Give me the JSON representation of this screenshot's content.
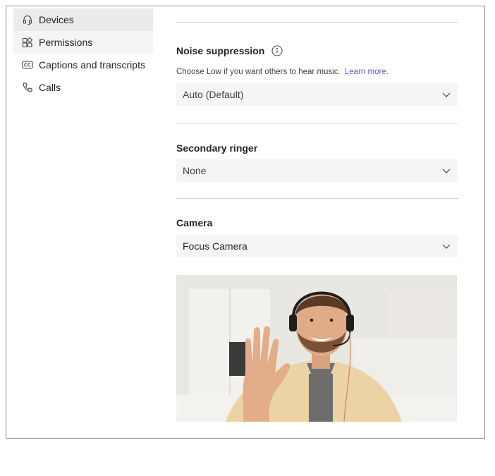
{
  "sidebar": {
    "items": [
      {
        "label": "Devices",
        "icon": "headset-icon",
        "state": "selected"
      },
      {
        "label": "Permissions",
        "icon": "permissions-icon",
        "state": "hover"
      },
      {
        "label": "Captions and transcripts",
        "icon": "closed-captions-icon",
        "state": "normal"
      },
      {
        "label": "Calls",
        "icon": "phone-icon",
        "state": "normal"
      }
    ]
  },
  "noise_suppression": {
    "title": "Noise suppression",
    "helper": "Choose Low if you want others to hear music.",
    "link": "Learn more.",
    "value": "Auto (Default)"
  },
  "secondary_ringer": {
    "title": "Secondary ringer",
    "value": "None"
  },
  "camera": {
    "title": "Camera",
    "value": "Focus Camera",
    "preview": "camera-preview-person-waving"
  },
  "colors": {
    "selected_bg": "#ebebeb",
    "dropdown_bg": "#f5f5f5",
    "link": "#5b5fc7",
    "divider": "#d1d1d1"
  }
}
